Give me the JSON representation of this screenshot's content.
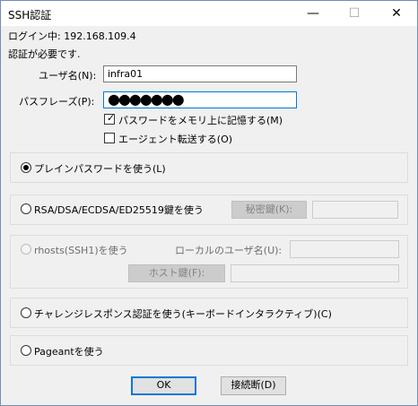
{
  "window": {
    "title": "SSH認証",
    "minimize_glyph": "—",
    "maximize_glyph": "☐",
    "close_glyph": "✕"
  },
  "header": {
    "login_label": "ログイン中: 192.168.109.4",
    "auth_required": "認証が必要です."
  },
  "fields": {
    "username_label": "ユーザ名(N):",
    "username_value": "infra01",
    "passphrase_label": "パスフレーズ(P):",
    "passphrase_dots": "●●●●●●●",
    "remember_label": "パスワードをメモリ上に記憶する(M)",
    "remember_checked": true,
    "agent_forward_label": "エージェント転送する(O)",
    "agent_forward_checked": false
  },
  "options": {
    "plain_password": "プレインパスワードを使う(L)",
    "rsa_key": "RSA/DSA/ECDSA/ED25519鍵を使う",
    "private_key_button": "秘密鍵(K):",
    "rhosts": "rhosts(SSH1)を使う",
    "local_user_label": "ローカルのユーザ名(U):",
    "host_key_button": "ホスト鍵(F):",
    "challenge": "チャレンジレスポンス認証を使う(キーボードインタラクティブ)(C)",
    "pageant": "Pageantを使う",
    "selected": "plain_password"
  },
  "buttons": {
    "ok": "OK",
    "disconnect": "接続断(D)"
  },
  "colors": {
    "focus_border": "#0078d7",
    "window_bg": "#f0f0f0"
  }
}
